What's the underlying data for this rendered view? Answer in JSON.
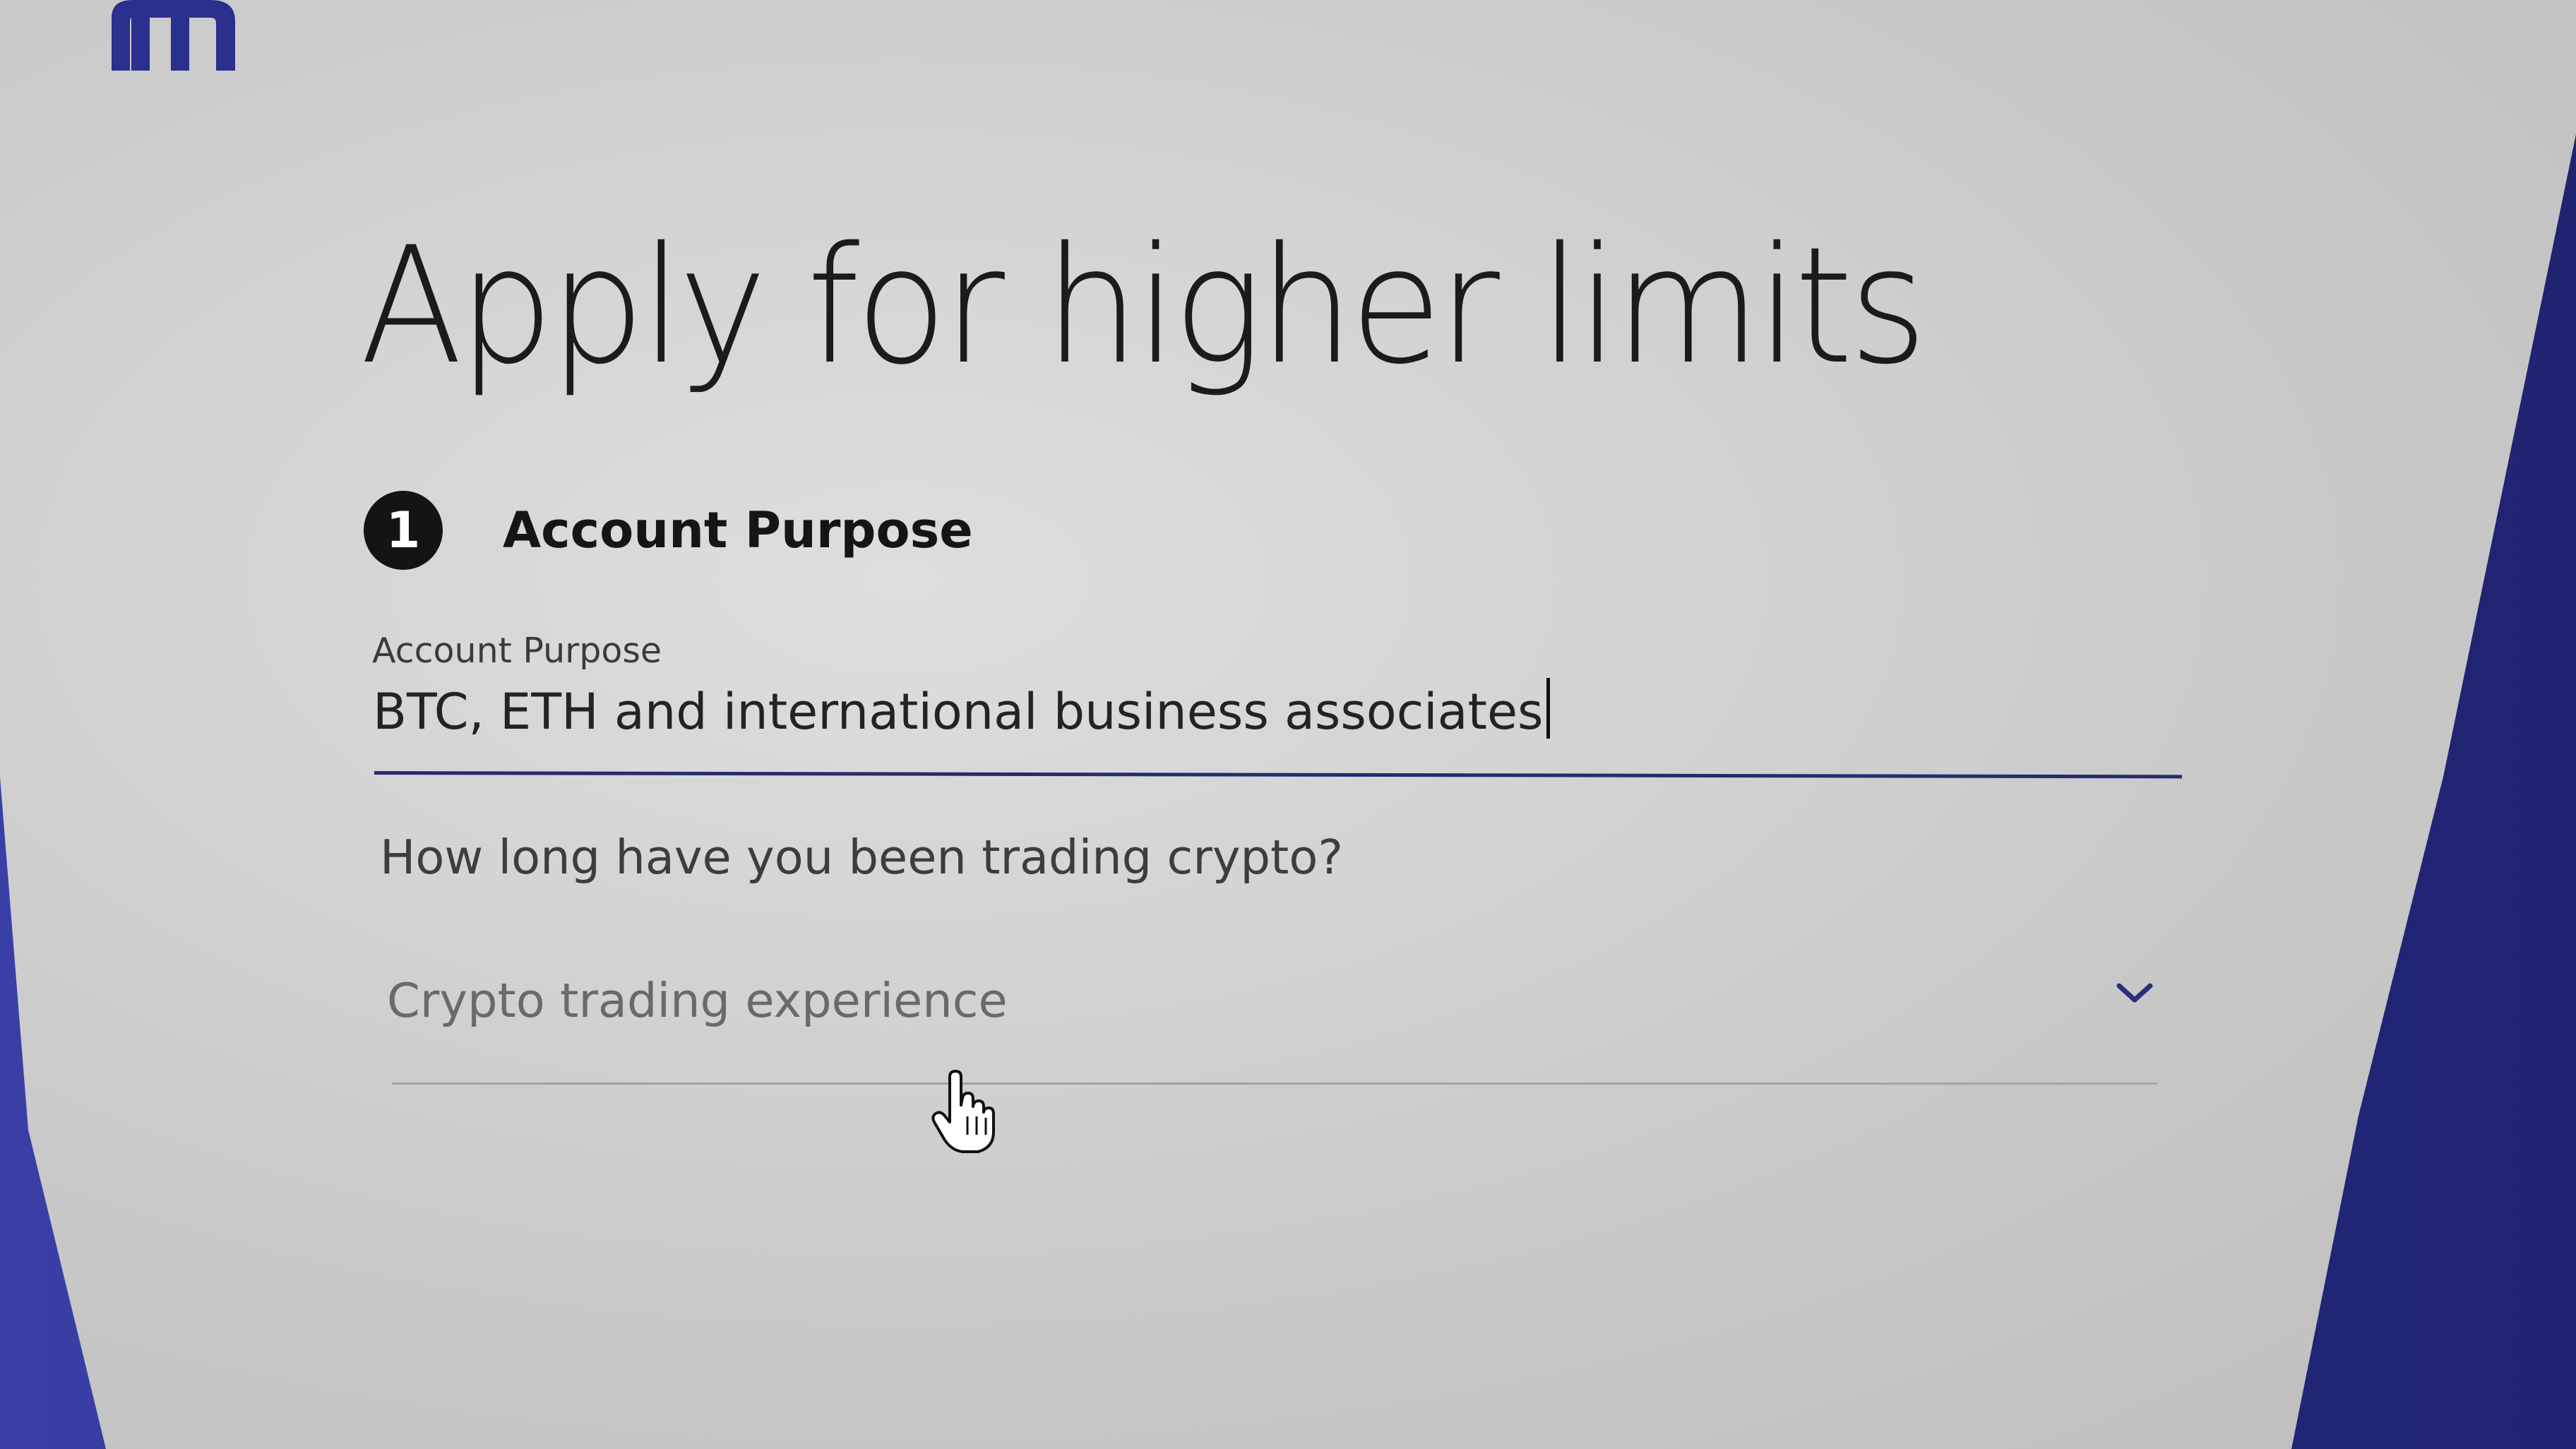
{
  "brand": {
    "logo_icon": "m-logo-icon",
    "color": "#2b2f8e"
  },
  "page": {
    "title": "Apply for higher limits"
  },
  "step": {
    "number": "1",
    "title": "Account Purpose"
  },
  "account_purpose": {
    "label": "Account Purpose",
    "value": "BTC, ETH and international business associates"
  },
  "experience": {
    "question": "How long have you been trading crypto?",
    "placeholder": "Crypto trading experience",
    "chevron_icon": "chevron-down-icon"
  },
  "pointer": {
    "icon": "hand-pointer-icon"
  },
  "colors": {
    "accent": "#262a6e",
    "panel": "#d4d4d4",
    "background": "#2a2f8a"
  }
}
